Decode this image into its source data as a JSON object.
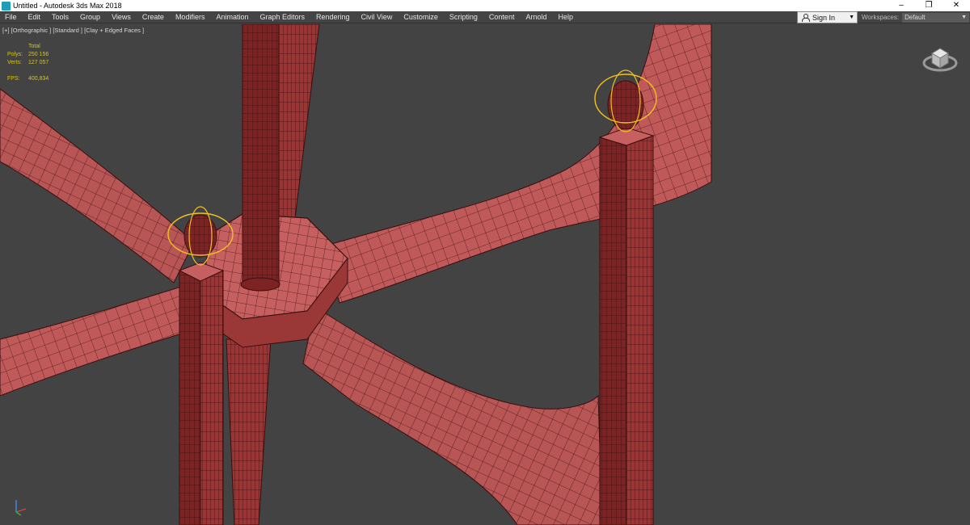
{
  "window": {
    "title": "Untitled - Autodesk 3ds Max 2018",
    "controls": {
      "minimize": "–",
      "restore": "❐",
      "close": "✕"
    }
  },
  "menu": {
    "items": [
      "File",
      "Edit",
      "Tools",
      "Group",
      "Views",
      "Create",
      "Modifiers",
      "Animation",
      "Graph Editors",
      "Rendering",
      "Civil View",
      "Customize",
      "Scripting",
      "Content",
      "Arnold",
      "Help"
    ],
    "signin": "Sign In",
    "workspaces_label": "Workspaces:",
    "workspace_value": "Default"
  },
  "viewport": {
    "label": "[+] [Orthographic ] [Standard ] [Clay + Edged Faces ]",
    "stats": {
      "total_label": "Total",
      "polys_label": "Polys:",
      "polys": "250 156",
      "verts_label": "Verts:",
      "verts": "127 057",
      "fps_label": "FPS:",
      "fps": "400,834"
    }
  },
  "colors": {
    "viewport_bg": "#434343",
    "clay_fill": "#b85555",
    "clay_dark": "#7a2a2a",
    "wire": "#3a0f0f",
    "gizmo": "#f0c020",
    "stats_text": "#d4c41e"
  }
}
